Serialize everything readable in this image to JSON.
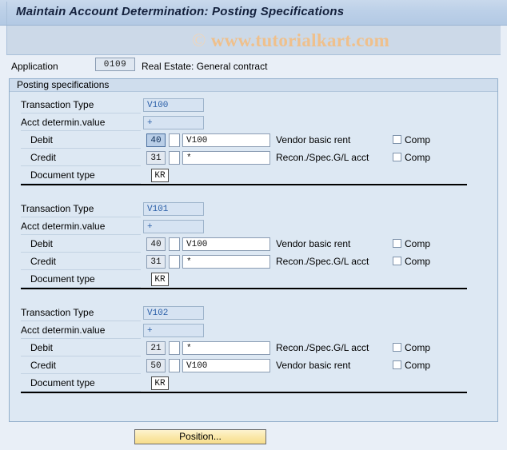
{
  "window": {
    "title": "Maintain Account Determination: Posting Specifications"
  },
  "watermark": {
    "copyright_symbol": "©",
    "text": "www.tutorialkart.com"
  },
  "application": {
    "label": "Application",
    "value": "0109",
    "description": "Real Estate: General contract"
  },
  "group": {
    "header": "Posting specifications"
  },
  "labels": {
    "transaction_type": "Transaction Type",
    "acct_determin_value": "Acct determin.value",
    "debit": "Debit",
    "credit": "Credit",
    "document_type": "Document type",
    "comp": "Comp"
  },
  "blocks": [
    {
      "transaction_type": "V100",
      "acct_determin_value": "+",
      "debit": {
        "posting_key": "40",
        "modifier": "",
        "account": "V100",
        "description": "Vendor basic rent",
        "comp_label": "Comp",
        "comp_checked": false,
        "focused": true
      },
      "credit": {
        "posting_key": "31",
        "modifier": "",
        "account": "*",
        "description": "Recon./Spec.G/L acct",
        "comp_label": "Comp",
        "comp_checked": false,
        "focused": false
      },
      "document_type": "KR"
    },
    {
      "transaction_type": "V101",
      "acct_determin_value": "+",
      "debit": {
        "posting_key": "40",
        "modifier": "",
        "account": "V100",
        "description": "Vendor basic rent",
        "comp_label": "Comp",
        "comp_checked": false,
        "focused": false
      },
      "credit": {
        "posting_key": "31",
        "modifier": "",
        "account": "*",
        "description": "Recon./Spec.G/L acct",
        "comp_label": "Comp",
        "comp_checked": false,
        "focused": false
      },
      "document_type": "KR"
    },
    {
      "transaction_type": "V102",
      "acct_determin_value": "+",
      "debit": {
        "posting_key": "21",
        "modifier": "",
        "account": "*",
        "description": "Recon./Spec.G/L acct",
        "comp_label": "Comp",
        "comp_checked": false,
        "focused": false
      },
      "credit": {
        "posting_key": "50",
        "modifier": "",
        "account": "V100",
        "description": "Vendor basic rent",
        "comp_label": "Comp",
        "comp_checked": false,
        "focused": false
      },
      "document_type": "KR"
    }
  ],
  "footer": {
    "position_button": "Position..."
  },
  "colors": {
    "title_bar": "#bcd0e8",
    "panel": "#dde8f3",
    "page_background": "#e9eff7",
    "watermark": "#efc08c",
    "button": "#fae8a9",
    "readonly_text": "#2a5fa8"
  }
}
